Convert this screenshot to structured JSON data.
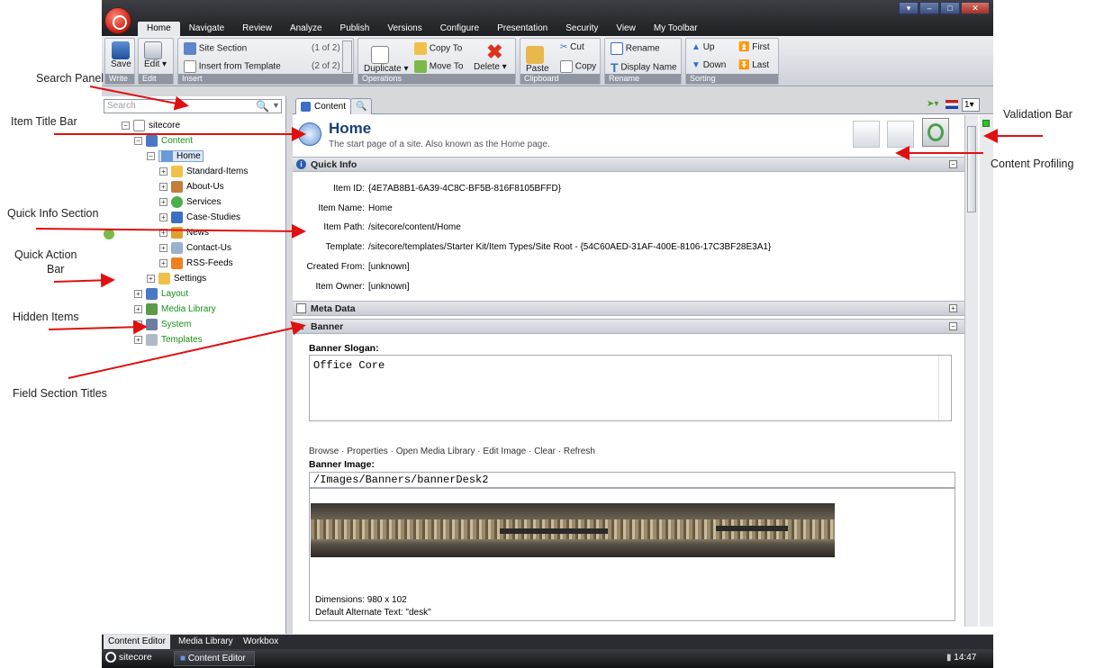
{
  "annotations": {
    "search_panel": "Search Panel",
    "item_title_bar": "Item Title Bar",
    "quick_info_section": "Quick Info Section",
    "quick_action_bar_1": "Quick Action",
    "quick_action_bar_2": "Bar",
    "hidden_items": "Hidden Items",
    "field_section_titles": "Field Section Titles",
    "validation_bar": "Validation Bar",
    "content_profiling": "Content Profiling"
  },
  "menu_tabs": [
    "Home",
    "Navigate",
    "Review",
    "Analyze",
    "Publish",
    "Versions",
    "Configure",
    "Presentation",
    "Security",
    "View",
    "My Toolbar"
  ],
  "ribbon": {
    "write": {
      "save": "Save",
      "group": "Write"
    },
    "edit": {
      "edit": "Edit",
      "group": "Edit"
    },
    "insert": {
      "site_section": "Site Section",
      "site_section_count": "(1 of 2)",
      "insert_from_template": "Insert from Template",
      "insert_count": "(2 of 2)",
      "group": "Insert"
    },
    "operations": {
      "duplicate": "Duplicate",
      "copy_to": "Copy To",
      "move_to": "Move To",
      "delete": "Delete",
      "group": "Operations"
    },
    "clipboard": {
      "paste": "Paste",
      "cut": "Cut",
      "copy": "Copy",
      "group": "Clipboard"
    },
    "rename": {
      "rename": "Rename",
      "display_name": "Display Name",
      "group": "Rename"
    },
    "sorting": {
      "up": "Up",
      "down": "Down",
      "first": "First",
      "last": "Last",
      "group": "Sorting"
    }
  },
  "search": {
    "placeholder": "Search"
  },
  "tree": {
    "root": "sitecore",
    "content": "Content",
    "home": "Home",
    "children": [
      "Standard-Items",
      "About-Us",
      "Services",
      "Case-Studies",
      "News",
      "Contact-Us",
      "RSS-Feeds",
      "Settings"
    ],
    "layout": "Layout",
    "media_library": "Media Library",
    "system": "System",
    "templates": "Templates"
  },
  "content_tab": "Content",
  "language_version": "1",
  "item": {
    "title": "Home",
    "description": "The start page of a site. Also known as the Home page."
  },
  "quick_info": {
    "header": "Quick Info",
    "rows": [
      {
        "label": "Item ID:",
        "value": "{4E7AB8B1-6A39-4C8C-BF5B-816F8105BFFD}"
      },
      {
        "label": "Item Name:",
        "value": "Home"
      },
      {
        "label": "Item Path:",
        "value": "/sitecore/content/Home"
      },
      {
        "label": "Template:",
        "value": "/sitecore/templates/Starter Kit/Item Types/Site Root - {54C60AED-31AF-400E-8106-17C3BF28E3A1}"
      },
      {
        "label": "Created From:",
        "value": "[unknown]"
      },
      {
        "label": "Item Owner:",
        "value": "[unknown]"
      }
    ]
  },
  "sections": {
    "meta_data": "Meta Data",
    "banner": "Banner"
  },
  "banner": {
    "slogan_label": "Banner Slogan:",
    "slogan_value": "Office Core",
    "image_actions": "Browse · Properties · Open Media Library · Edit Image · Clear · Refresh",
    "image_label": "Banner Image:",
    "image_path": "/Images/Banners/bannerDesk2",
    "dimensions": "Dimensions: 980 x 102",
    "alt_text": "Default Alternate Text: \"desk\""
  },
  "bottom_tabs": [
    "Content Editor",
    "Media Library",
    "Workbox"
  ],
  "taskbar": {
    "start": "sitecore",
    "app": "Content Editor",
    "clock": "14:47"
  }
}
